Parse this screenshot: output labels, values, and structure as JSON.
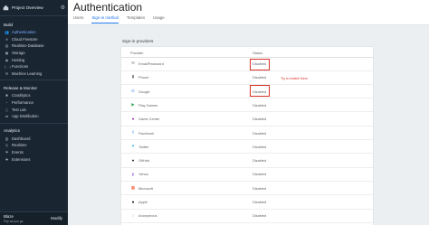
{
  "sidebar": {
    "project_label": "Project Overview",
    "build_label": "Build",
    "build_items": [
      {
        "label": "Authentication",
        "icon": "people-icon",
        "glyph": "👥",
        "active": true
      },
      {
        "label": "Cloud Firestore",
        "icon": "firestore-icon",
        "glyph": "≋"
      },
      {
        "label": "Realtime Database",
        "icon": "database-icon",
        "glyph": "▤"
      },
      {
        "label": "Storage",
        "icon": "storage-icon",
        "glyph": "▣"
      },
      {
        "label": "Hosting",
        "icon": "hosting-icon",
        "glyph": "◉"
      },
      {
        "label": "Functions",
        "icon": "functions-icon",
        "glyph": "(…)"
      },
      {
        "label": "Machine Learning",
        "icon": "robot-icon",
        "glyph": "⚙"
      }
    ],
    "release_label": "Release & Monitor",
    "release_items": [
      {
        "label": "Crashlytics",
        "icon": "crashlytics-icon",
        "glyph": "✱"
      },
      {
        "label": "Performance",
        "icon": "gauge-icon",
        "glyph": "◔"
      },
      {
        "label": "Test Lab",
        "icon": "testlab-icon",
        "glyph": "▯"
      },
      {
        "label": "App Distribution",
        "icon": "distribution-icon",
        "glyph": "⇄"
      }
    ],
    "analytics_label": "Analytics",
    "analytics_items": [
      {
        "label": "Dashboard",
        "icon": "dashboard-icon",
        "glyph": "▥"
      },
      {
        "label": "Realtime",
        "icon": "realtime-icon",
        "glyph": "◷"
      },
      {
        "label": "Events",
        "icon": "events-icon",
        "glyph": "⚑"
      },
      {
        "label": "Extensions",
        "icon": "extensions-icon",
        "glyph": "✚"
      }
    ],
    "plan_name": "Blaze",
    "plan_sub": "Pay as you go",
    "modify_label": "Modify"
  },
  "header": {
    "title": "Authentication",
    "tabs": [
      {
        "label": "Users"
      },
      {
        "label": "Sign-in method",
        "active": true
      },
      {
        "label": "Templates"
      },
      {
        "label": "Usage"
      }
    ]
  },
  "providers": {
    "section_title": "Sign-in providers",
    "col_provider": "Provider",
    "col_status": "Status",
    "rows": [
      {
        "name": "Email/Password",
        "status": "Disabled",
        "icon": "email-icon",
        "glyph": "✉",
        "color": "#757575"
      },
      {
        "name": "Phone",
        "status": "Disabled",
        "icon": "phone-icon",
        "glyph": "▮",
        "color": "#757575"
      },
      {
        "name": "Google",
        "status": "Disabled",
        "icon": "google-icon",
        "glyph": "G",
        "color": "#4285f4"
      },
      {
        "name": "Play Games",
        "status": "Disabled",
        "icon": "play-games-icon",
        "glyph": "▶",
        "color": "#34a853"
      },
      {
        "name": "Game Center",
        "status": "Disabled",
        "icon": "game-center-icon",
        "glyph": "●",
        "color": "#9c27b0"
      },
      {
        "name": "Facebook",
        "status": "Disabled",
        "icon": "facebook-icon",
        "glyph": "f",
        "color": "#1877f2"
      },
      {
        "name": "Twitter",
        "status": "Disabled",
        "icon": "twitter-icon",
        "glyph": "✦",
        "color": "#1da1f2"
      },
      {
        "name": "GitHub",
        "status": "Disabled",
        "icon": "github-icon",
        "glyph": "●",
        "color": "#24292e"
      },
      {
        "name": "Yahoo",
        "status": "Disabled",
        "icon": "yahoo-icon",
        "glyph": "y",
        "color": "#6001d2"
      },
      {
        "name": "Microsoft",
        "status": "Disabled",
        "icon": "microsoft-icon",
        "glyph": "▦",
        "color": "#f25022"
      },
      {
        "name": "Apple",
        "status": "Disabled",
        "icon": "apple-icon",
        "glyph": "●",
        "color": "#000000"
      },
      {
        "name": "Anonymous",
        "status": "Disabled",
        "icon": "anonymous-icon",
        "glyph": "◌",
        "color": "#757575"
      }
    ]
  },
  "annotation": "Try to enable them",
  "colors": {
    "highlight": "#d93025",
    "accent": "#1a73e8",
    "sidebar_bg": "#1a2532"
  }
}
